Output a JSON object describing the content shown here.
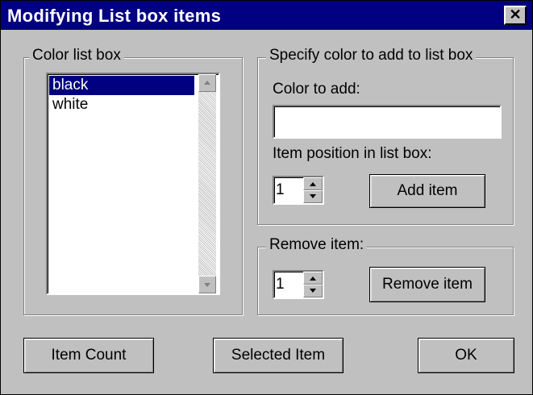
{
  "window": {
    "title": "Modifying List box items",
    "close_icon": "close-icon"
  },
  "color_group": {
    "legend": "Color list box",
    "items": [
      "black",
      "white"
    ],
    "selected_index": 0
  },
  "add_group": {
    "legend": "Specify color to add to list box",
    "color_label": "Color to add:",
    "color_value": "",
    "position_label": "Item position in list box:",
    "position_value": "1",
    "add_button": "Add item"
  },
  "remove_group": {
    "legend": "Remove item:",
    "position_value": "1",
    "remove_button": "Remove item"
  },
  "buttons": {
    "item_count": "Item Count",
    "selected_item": "Selected Item",
    "ok": "OK"
  },
  "colors": {
    "titlebar": "#000080",
    "face": "#c0c0c0",
    "selection": "#000080"
  }
}
